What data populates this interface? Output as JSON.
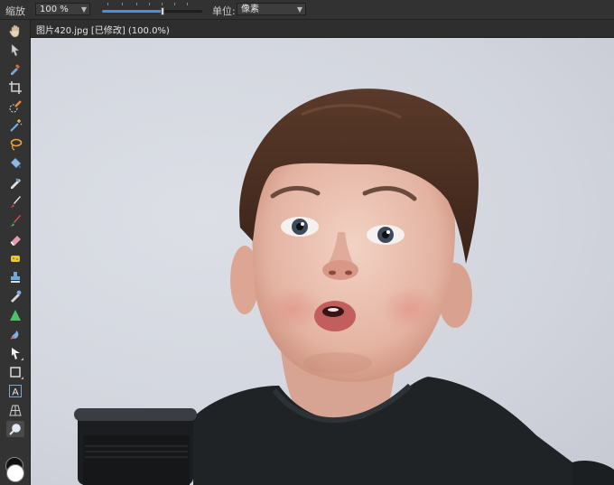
{
  "toolbar": {
    "zoom_label": "缩放",
    "zoom_value": "100 %",
    "zoom_slider_fraction": 0.6,
    "unit_label": "单位:",
    "unit_value": "像素"
  },
  "document": {
    "tab_title": "图片420.jpg [已修改] (100.0%)"
  },
  "tools": [
    {
      "name": "hand-tool",
      "icon": "hand-icon",
      "active": false
    },
    {
      "name": "move-tool",
      "icon": "arrow-pointer-icon",
      "active": false
    },
    {
      "name": "color-picker-tool",
      "icon": "eyedropper-icon",
      "active": false
    },
    {
      "name": "crop-tool",
      "icon": "crop-icon",
      "active": false
    },
    {
      "name": "selection-brush-tool",
      "icon": "selection-brush-icon",
      "active": false
    },
    {
      "name": "magic-wand-tool",
      "icon": "magic-wand-icon",
      "active": false
    },
    {
      "name": "freehand-selection-tool",
      "icon": "lasso-icon",
      "active": false
    },
    {
      "name": "flood-fill-tool",
      "icon": "paint-bucket-icon",
      "active": false
    },
    {
      "name": "gradient-tool",
      "icon": "gradient-icon",
      "active": false
    },
    {
      "name": "paint-brush-tool",
      "icon": "paintbrush-icon",
      "active": false
    },
    {
      "name": "color-replacement-tool",
      "icon": "color-brush-icon",
      "active": false
    },
    {
      "name": "erase-brush-tool",
      "icon": "eraser-icon",
      "active": false
    },
    {
      "name": "dodge-tool",
      "icon": "sponge-icon",
      "active": false
    },
    {
      "name": "clone-tool",
      "icon": "stamp-icon",
      "active": false
    },
    {
      "name": "blemish-removal-tool",
      "icon": "healing-brush-icon",
      "active": false
    },
    {
      "name": "sharpen-tool",
      "icon": "triangle-icon",
      "active": false
    },
    {
      "name": "smudge-tool",
      "icon": "smudge-icon",
      "active": false
    },
    {
      "name": "node-tool",
      "icon": "node-pointer-icon",
      "active": false
    },
    {
      "name": "rectangle-tool",
      "icon": "rectangle-icon",
      "active": false
    },
    {
      "name": "artistic-text-tool",
      "icon": "text-icon",
      "active": false
    },
    {
      "name": "mesh-warp-tool",
      "icon": "mesh-icon",
      "active": false
    },
    {
      "name": "zoom-tool",
      "icon": "magnifier-icon",
      "active": true
    }
  ],
  "colors": {
    "primary": "#ffffff",
    "secondary": "#111111",
    "accent": "#4a90d6"
  }
}
